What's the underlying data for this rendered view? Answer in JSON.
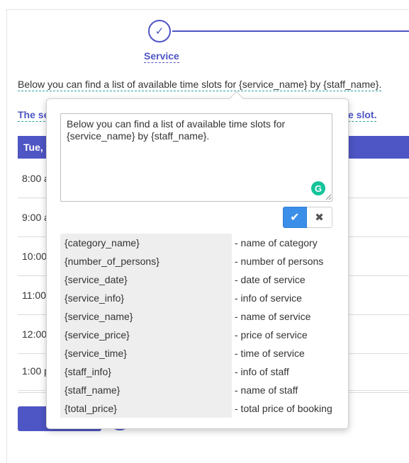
{
  "step": {
    "check_glyph": "✓",
    "label": "Service"
  },
  "info_text": "Below you can find a list of available time slots for {service_name} by {staff_name}.",
  "hint": {
    "left": "The se",
    "right": "e slot."
  },
  "day_header": "Tue, I",
  "time_slots": [
    "8:00 a",
    "9:00 a",
    "10:00",
    "11:00",
    "12:00",
    "1:00 p"
  ],
  "popover": {
    "editor_value": "Below you can find a list of available time slots for {service_name} by {staff_name}.",
    "grammarly_glyph": "G",
    "save_glyph": "✔",
    "cancel_glyph": "✖",
    "codes": [
      {
        "code": "{category_name}",
        "desc": "- name of category"
      },
      {
        "code": "{number_of_persons}",
        "desc": "- number of persons"
      },
      {
        "code": "{service_date}",
        "desc": "- date of service"
      },
      {
        "code": "{service_info}",
        "desc": "- info of service"
      },
      {
        "code": "{service_name}",
        "desc": "- name of service"
      },
      {
        "code": "{service_price}",
        "desc": "- price of service"
      },
      {
        "code": "{service_time}",
        "desc": "- time of service"
      },
      {
        "code": "{staff_info}",
        "desc": "- info of staff"
      },
      {
        "code": "{staff_name}",
        "desc": "- name of staff"
      },
      {
        "code": "{total_price}",
        "desc": "- total price of booking"
      }
    ]
  },
  "colors": {
    "accent": "#4e55c4",
    "save": "#3b8fe8",
    "grammarly": "#15c39a"
  }
}
